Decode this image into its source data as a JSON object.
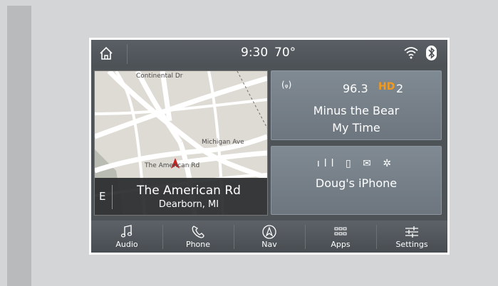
{
  "status_bar": {
    "time": "9:30",
    "temperature": "70°"
  },
  "map": {
    "street_labels": [
      "Continental Dr",
      "Michigan Ave",
      "The American Rd"
    ],
    "direction": "E",
    "current_street": "The American Rd",
    "current_city": "Dearborn, MI"
  },
  "radio": {
    "frequency": "96.3",
    "hd_label": "HD",
    "channel": "2",
    "artist": "Minus the Bear",
    "song": "My Time"
  },
  "phone": {
    "status_icons": "ıll ▯ ✉ ✲",
    "device_name": "Doug's iPhone"
  },
  "nav_bar": {
    "items": [
      {
        "label": "Audio",
        "icon": "music-note-icon"
      },
      {
        "label": "Phone",
        "icon": "phone-handset-icon"
      },
      {
        "label": "Nav",
        "icon": "navigation-arrow-icon"
      },
      {
        "label": "Apps",
        "icon": "apps-grid-icon"
      },
      {
        "label": "Settings",
        "icon": "sliders-icon"
      }
    ]
  },
  "colors": {
    "hd_accent": "#f39a1c",
    "tile": "#7a838b",
    "screen_bg": "#4e5358"
  }
}
